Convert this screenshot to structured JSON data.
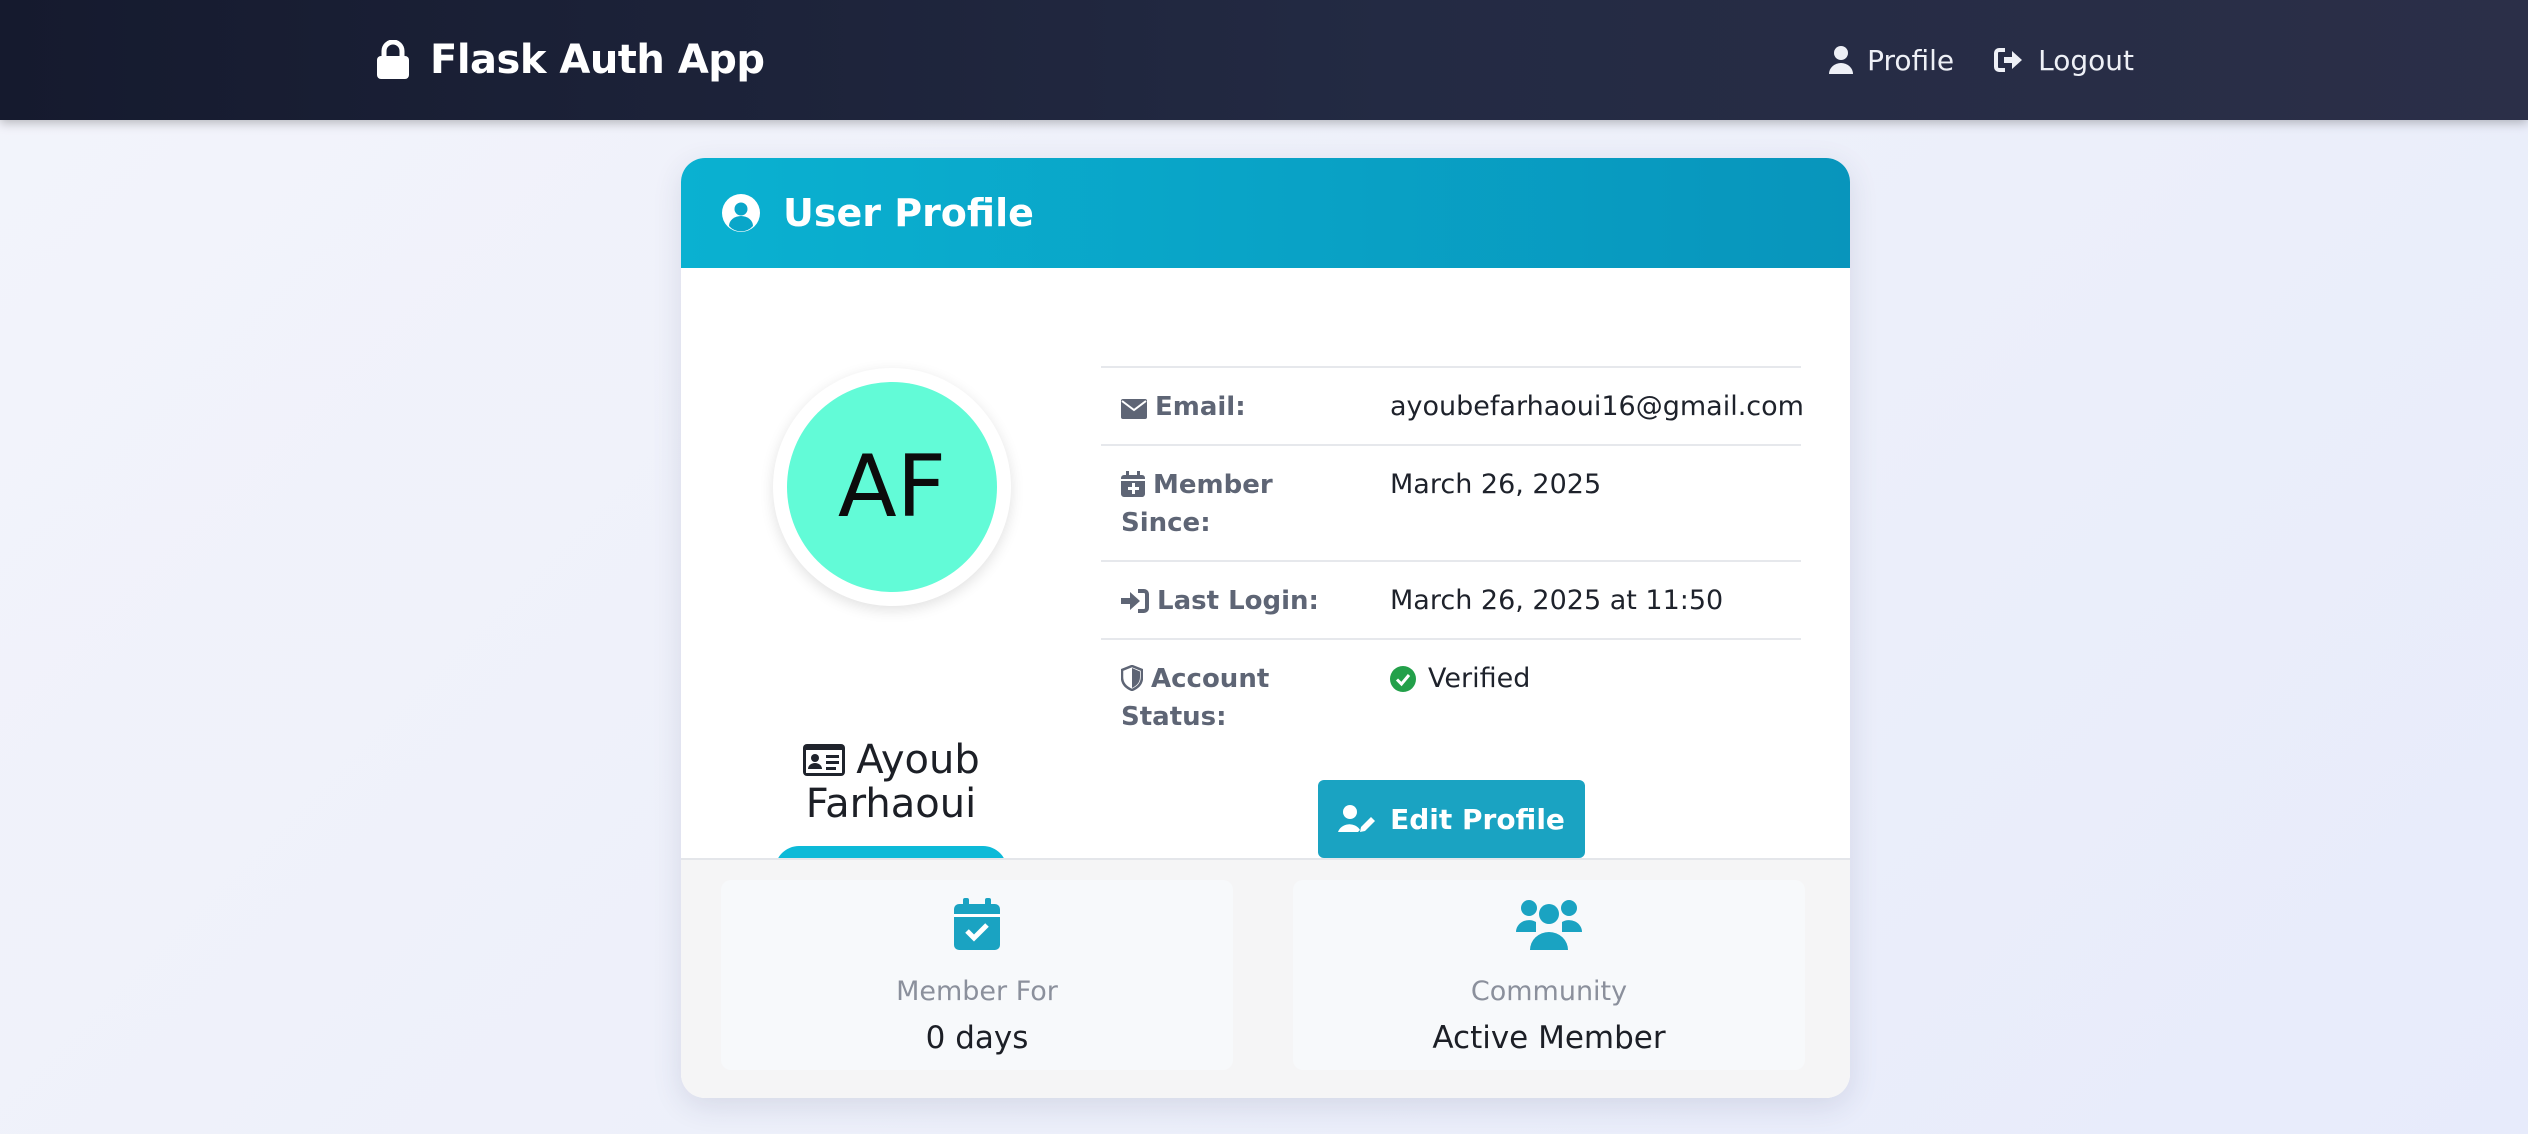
{
  "navbar": {
    "brand": "Flask Auth App",
    "links": [
      {
        "label": "Profile",
        "icon": "user-icon"
      },
      {
        "label": "Logout",
        "icon": "sign-out-icon"
      }
    ]
  },
  "card": {
    "title": "User Profile",
    "avatar_initials": "AF",
    "user_name": "Ayoub Farhaoui",
    "status_badge": "Active Member",
    "info": [
      {
        "label": "Email:",
        "value": "ayoubefarhaoui16@gmail.com",
        "icon": "envelope-icon"
      },
      {
        "label": "Member Since:",
        "value": "March 26, 2025",
        "icon": "calendar-plus-icon"
      },
      {
        "label": "Last Login:",
        "value": "March 26, 2025 at 11:50",
        "icon": "sign-in-icon"
      },
      {
        "label": "Account Status:",
        "value": "Verified",
        "icon": "shield-icon"
      }
    ],
    "edit_button": "Edit Profile",
    "stats": [
      {
        "label": "Member For",
        "value": "0 days",
        "icon": "calendar-check-icon"
      },
      {
        "label": "Community",
        "value": "Active Member",
        "icon": "users-icon"
      }
    ]
  },
  "colors": {
    "navbar": "#1b2036",
    "header": "#0aa9ca",
    "accent": "#1aa3c2",
    "avatar": "#62fbd7",
    "verified": "#23a04a"
  }
}
